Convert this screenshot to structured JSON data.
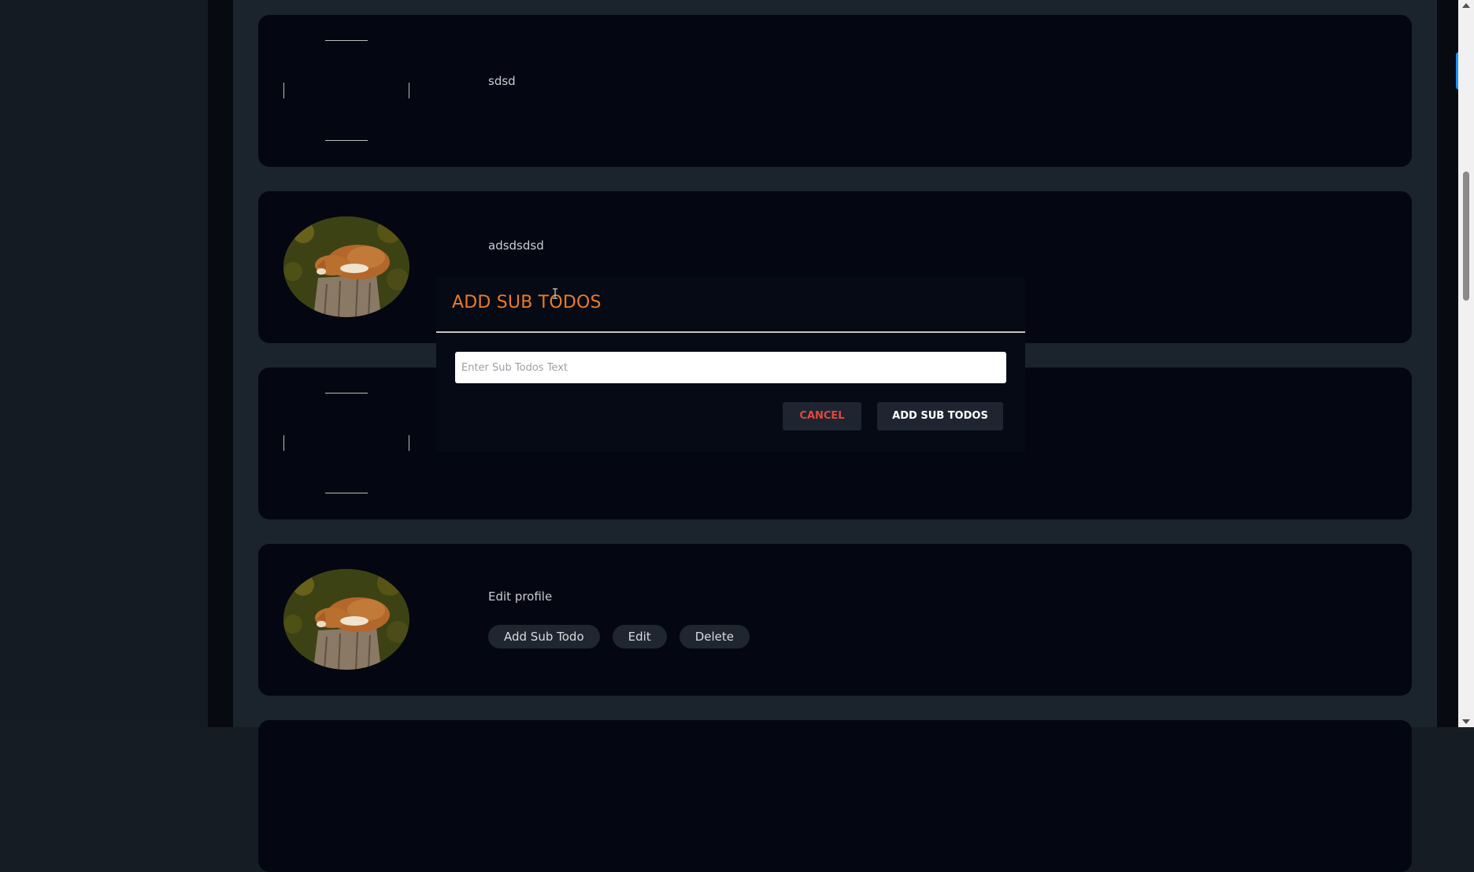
{
  "todos": [
    {
      "text": "sdsd",
      "image": "broken-image"
    },
    {
      "text": "adsdsdsd",
      "image": "fox-on-stump"
    },
    {
      "text": "",
      "image": "broken-image"
    },
    {
      "text": "Edit profile",
      "image": "fox-on-stump"
    }
  ],
  "actions": {
    "add_sub_todo": "Add Sub Todo",
    "edit": "Edit",
    "delete": "Delete"
  },
  "modal": {
    "title": "ADD SUB TODOS",
    "input_placeholder": "Enter Sub Todos Text",
    "input_value": "",
    "cancel_label": "CANCEL",
    "submit_label": "ADD SUB TODOS"
  },
  "colors": {
    "page_bg": "#1b232c",
    "card_bg": "#040711",
    "modal_bg": "#050a14",
    "title_accent": "#ec7a26",
    "cancel_text": "#e0483c",
    "scroll_marker": "#1e90ff"
  }
}
